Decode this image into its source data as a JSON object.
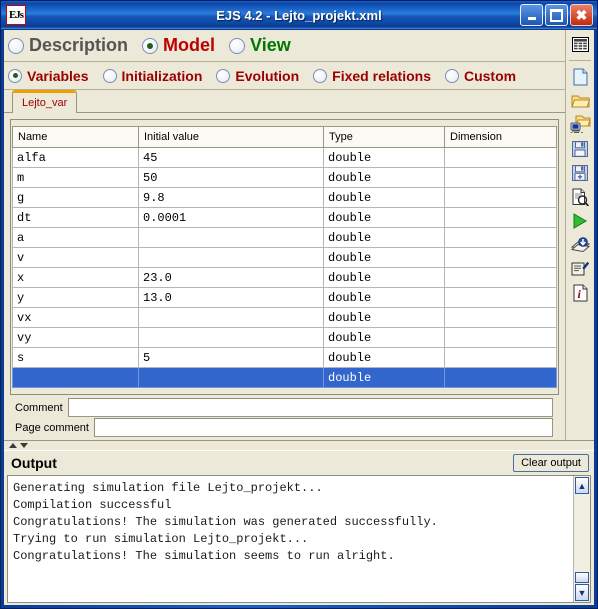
{
  "window": {
    "title": "EJS 4.2 - Lejto_projekt.xml",
    "app_icon_label": "EJs",
    "minimize_label": "Minimize",
    "maximize_label": "Maximize",
    "close_label": "Close"
  },
  "main_tabs": [
    {
      "label": "Description",
      "selected": false,
      "color": "#555555"
    },
    {
      "label": "Model",
      "selected": true,
      "color": "#c00000"
    },
    {
      "label": "View",
      "selected": false,
      "color": "#007800"
    }
  ],
  "sub_tabs": [
    {
      "label": "Variables",
      "selected": true
    },
    {
      "label": "Initialization",
      "selected": false
    },
    {
      "label": "Evolution",
      "selected": false
    },
    {
      "label": "Fixed relations",
      "selected": false
    },
    {
      "label": "Custom",
      "selected": false
    }
  ],
  "page_tab": {
    "label": "Lejto_var"
  },
  "table": {
    "headers": [
      "Name",
      "Initial value",
      "Type",
      "Dimension"
    ],
    "rows": [
      {
        "name": "alfa",
        "initial": "45",
        "type": "double",
        "dimension": "",
        "selected": false
      },
      {
        "name": "m",
        "initial": "50",
        "type": "double",
        "dimension": "",
        "selected": false
      },
      {
        "name": "g",
        "initial": "9.8",
        "type": "double",
        "dimension": "",
        "selected": false
      },
      {
        "name": "dt",
        "initial": "0.0001",
        "type": "double",
        "dimension": "",
        "selected": false
      },
      {
        "name": "a",
        "initial": "",
        "type": "double",
        "dimension": "",
        "selected": false
      },
      {
        "name": "v",
        "initial": "",
        "type": "double",
        "dimension": "",
        "selected": false
      },
      {
        "name": "x",
        "initial": "23.0",
        "type": "double",
        "dimension": "",
        "selected": false
      },
      {
        "name": "y",
        "initial": "13.0",
        "type": "double",
        "dimension": "",
        "selected": false
      },
      {
        "name": "vx",
        "initial": "",
        "type": "double",
        "dimension": "",
        "selected": false
      },
      {
        "name": "vy",
        "initial": "",
        "type": "double",
        "dimension": "",
        "selected": false
      },
      {
        "name": "s",
        "initial": "5",
        "type": "double",
        "dimension": "",
        "selected": false
      },
      {
        "name": "",
        "initial": "",
        "type": "double",
        "dimension": "",
        "selected": true
      }
    ]
  },
  "comment_fields": [
    {
      "label": "Comment",
      "value": "",
      "placeholder": ""
    },
    {
      "label": "Page comment",
      "value": "",
      "placeholder": ""
    }
  ],
  "toolbar": {
    "icons": [
      {
        "name": "table-view-icon",
        "title": "Table view"
      },
      {
        "name": "new-file-icon",
        "title": "New"
      },
      {
        "name": "open-folder-icon",
        "title": "Open"
      },
      {
        "name": "search-folder-icon",
        "title": "Search files"
      },
      {
        "name": "save-icon",
        "title": "Save"
      },
      {
        "name": "save-as-icon",
        "title": "Save as"
      },
      {
        "name": "preview-icon",
        "title": "Preview"
      },
      {
        "name": "run-icon",
        "title": "Run"
      },
      {
        "name": "package-icon",
        "title": "Package"
      },
      {
        "name": "options-icon",
        "title": "Options"
      },
      {
        "name": "info-icon",
        "title": "Information"
      }
    ]
  },
  "output": {
    "title": "Output",
    "clear_button": "Clear output",
    "lines": [
      "Generating simulation file Lejto_projekt...",
      "Compilation successful",
      "Congratulations! The simulation was generated successfully.",
      "Trying to run simulation Lejto_projekt...",
      "Congratulations! The simulation seems to run alright."
    ],
    "scroll_up": "▲",
    "scroll_down": "▼"
  },
  "colors": {
    "selected_row": "#3366cc",
    "accent_red": "#9b0000",
    "tab_orange": "#f0a000",
    "window_bg": "#ece9d8"
  }
}
